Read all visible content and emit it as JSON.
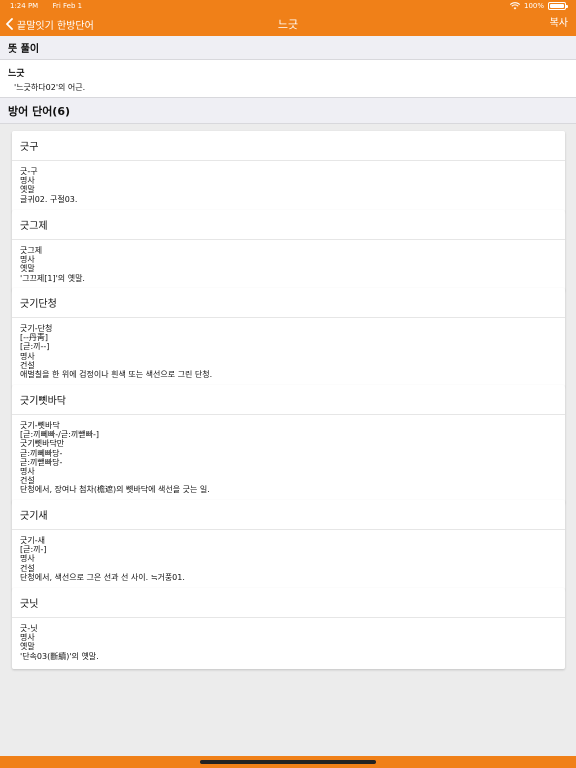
{
  "status_bar": {
    "time": "1:24 PM",
    "date": "Fri Feb 1",
    "battery": "100%"
  },
  "nav": {
    "back_label": "끝말잇기 한방단어",
    "title": "느긋",
    "copy_label": "복사"
  },
  "meaning_section": {
    "header": "뜻 풀이",
    "word": "느긋",
    "text": "'느긋하다02'의 어근."
  },
  "defense_section": {
    "header": "방어 단어(6)",
    "cards": [
      {
        "title": "긋구",
        "lines": [
          "긋-구",
          "명사",
          "옛말",
          "글귀02. 구절03."
        ]
      },
      {
        "title": "긋그제",
        "lines": [
          "긋그제",
          "명사",
          "옛말",
          "'그끄제[1]'의 옛말."
        ]
      },
      {
        "title": "긋기단청",
        "lines": [
          "긋기-단청",
          "[--丹靑]",
          "[귿:끼--]",
          "명사",
          "건설",
          "애벌칠을 한 위에 검정이나 흰색 또는 색선으로 그린 단청."
        ]
      },
      {
        "title": "긋기뼷바닥",
        "lines": [
          "긋기-뼷바닥",
          "[귿:끼뻬빠-/귿:끼뺃빠-]",
          "긋기뼷바닥만",
          "귿:끼뻬빠당-",
          "귿:끼뺃빠당-",
          "명사",
          "건설",
          "단청에서, 장여나 첨차(檐遮)의 뼷바닥에 색선을 긋는 일."
        ]
      },
      {
        "title": "긋기새",
        "lines": [
          "긋기-새",
          "[귿:끼-]",
          "명사",
          "건설",
          "단청에서, 색선으로 그은 선과 선 사이. ≒거풍01."
        ]
      },
      {
        "title": "긋닛",
        "lines": [
          "긋-닛",
          "명사",
          "옛말",
          "'단속03(斷續)'의 옛말."
        ]
      }
    ]
  }
}
